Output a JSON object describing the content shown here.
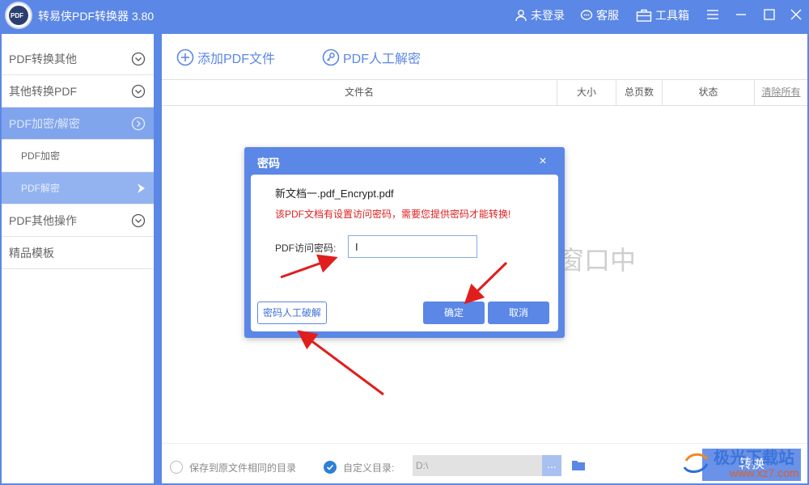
{
  "app": {
    "title": "转易侠PDF转换器 3.80",
    "logo_text": "PDF",
    "login": "未登录",
    "service": "客服",
    "toolbox": "工具箱"
  },
  "sidebar": {
    "items": [
      {
        "label": "PDF转换其他",
        "icon": "chevron-down-circle-icon"
      },
      {
        "label": "其他转换PDF",
        "icon": "chevron-down-circle-icon"
      },
      {
        "label": "PDF加密/解密",
        "icon": "chevron-right-circle-icon",
        "active": true
      },
      {
        "label": "PDF加密"
      },
      {
        "label": "PDF解密",
        "selected": true
      },
      {
        "label": "PDF其他操作",
        "icon": "chevron-down-circle-icon"
      },
      {
        "label": "精品模板"
      }
    ]
  },
  "toolbar": {
    "add_file": "添加PDF文件",
    "manual_decrypt": "PDF人工解密"
  },
  "table": {
    "headers": [
      "文件名",
      "大小",
      "总页数",
      "状态",
      "清除所有"
    ]
  },
  "drop_hint": "窗口中",
  "footer": {
    "same_dir_label": "保存到原文件相同的目录",
    "custom_dir_label": "自定义目录:",
    "path_value": "D:\\",
    "browse_label": "...",
    "convert_label": "转换"
  },
  "dialog": {
    "title": "密码",
    "close": "×",
    "file_name": "新文档一.pdf_Encrypt.pdf",
    "warning": "该PDF文档有设置访问密码，需要您提供密码才能转换!",
    "password_label": "PDF访问密码:",
    "password_value": "I",
    "manual_crack": "密码人工破解",
    "ok": "确定",
    "cancel": "取消"
  },
  "watermark": {
    "text": "极光下载站",
    "sub": "www.xz7.com"
  },
  "colors": {
    "brand": "#5b87e6",
    "warning": "#e02020",
    "annotation_arrow": "#e01e1e"
  }
}
